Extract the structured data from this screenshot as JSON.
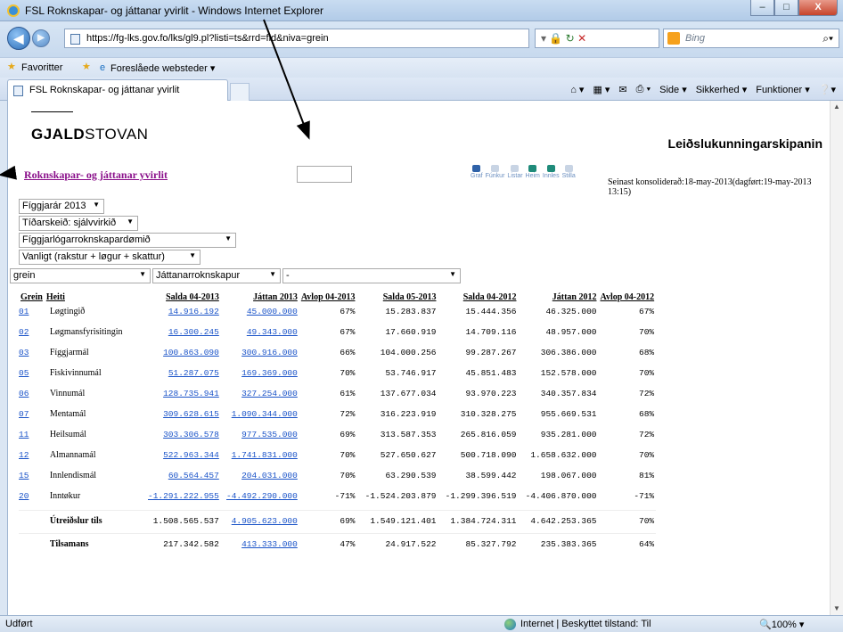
{
  "window": {
    "title": "FSL Roknskapar- og játtanar yvirlit - Windows Internet Explorer",
    "minimize": "–",
    "maximize": "□",
    "close": "X"
  },
  "addressbar": {
    "url": "https://fg-lks.gov.fo/lks/gl9.pl?listi=ts&rrd=fld&niva=grein",
    "search_placeholder": "Bing"
  },
  "favorites": {
    "favoritter": "Favoritter",
    "suggested": "Foreslåede websteder ▾"
  },
  "tab": {
    "label": "FSL Roknskapar- og játtanar yvirlit"
  },
  "commandbar": {
    "side": "Side ▾",
    "sikkerhed": "Sikkerhed ▾",
    "funktioner": "Funktioner ▾"
  },
  "page": {
    "logo_bold": "GJALD",
    "logo_rest": "STOVAN",
    "site_title": "Leiðslukunningarskipanin",
    "title": "Roknskapar- og játtanar yvirlit",
    "tools": [
      "Graf",
      "Fúnkur",
      "Listar",
      "Heim",
      "Innles",
      "Stilla"
    ],
    "consolidated": "Seinast konsoliderað:18-may-2013(dagført:19-may-2013 13:15)"
  },
  "filters": {
    "year": "Fíggjarár 2013",
    "period": "Tíðarskeið: sjálvvirkið",
    "area": "Fíggjarlógarroknskapardømið",
    "type": "Vanligt (rakstur + løgur + skattur)",
    "level": "grein",
    "account": "Játtanarroknskapur",
    "dash": "-"
  },
  "table": {
    "headers": [
      "Grein",
      "Heiti",
      "Salda 04-2013",
      "Játtan 2013",
      "Avlop 04-2013",
      "Salda 05-2013",
      "Salda 04-2012",
      "Játtan 2012",
      "Avlop 04-2012"
    ],
    "rows": [
      {
        "code": "01",
        "name": "Løgtingið",
        "s0413": "14.916.192",
        "j13": "45.000.000",
        "a0413": "67%",
        "s0513": "15.283.837",
        "s0412": "15.444.356",
        "j12": "46.325.000",
        "a0412": "67%"
      },
      {
        "code": "02",
        "name": "Løgmansfyrisitingin",
        "s0413": "16.300.245",
        "j13": "49.343.000",
        "a0413": "67%",
        "s0513": "17.660.919",
        "s0412": "14.709.116",
        "j12": "48.957.000",
        "a0412": "70%"
      },
      {
        "code": "03",
        "name": "Fíggjarmál",
        "s0413": "100.863.090",
        "j13": "300.916.000",
        "a0413": "66%",
        "s0513": "104.000.256",
        "s0412": "99.287.267",
        "j12": "306.386.000",
        "a0412": "68%"
      },
      {
        "code": "05",
        "name": "Fiskivinnumál",
        "s0413": "51.287.075",
        "j13": "169.369.000",
        "a0413": "70%",
        "s0513": "53.746.917",
        "s0412": "45.851.483",
        "j12": "152.578.000",
        "a0412": "70%"
      },
      {
        "code": "06",
        "name": "Vinnumál",
        "s0413": "128.735.941",
        "j13": "327.254.000",
        "a0413": "61%",
        "s0513": "137.677.034",
        "s0412": "93.970.223",
        "j12": "340.357.834",
        "a0412": "72%"
      },
      {
        "code": "07",
        "name": "Mentamál",
        "s0413": "309.628.615",
        "j13": "1.090.344.000",
        "a0413": "72%",
        "s0513": "316.223.919",
        "s0412": "310.328.275",
        "j12": "955.669.531",
        "a0412": "68%"
      },
      {
        "code": "11",
        "name": "Heilsumál",
        "s0413": "303.306.578",
        "j13": "977.535.000",
        "a0413": "69%",
        "s0513": "313.587.353",
        "s0412": "265.816.059",
        "j12": "935.281.000",
        "a0412": "72%"
      },
      {
        "code": "12",
        "name": "Almannamál",
        "s0413": "522.963.344",
        "j13": "1.741.831.000",
        "a0413": "70%",
        "s0513": "527.650.627",
        "s0412": "500.718.090",
        "j12": "1.658.632.000",
        "a0412": "70%"
      },
      {
        "code": "15",
        "name": "Innlendismál",
        "s0413": "60.564.457",
        "j13": "204.031.000",
        "a0413": "70%",
        "s0513": "63.290.539",
        "s0412": "38.599.442",
        "j12": "198.067.000",
        "a0412": "81%"
      },
      {
        "code": "20",
        "name": "Inntøkur",
        "s0413": "-1.291.222.955",
        "j13": "-4.492.290.000",
        "a0413": "-71%",
        "s0513": "-1.524.203.879",
        "s0412": "-1.299.396.519",
        "j12": "-4.406.870.000",
        "a0412": "-71%"
      }
    ],
    "totals": [
      {
        "name": "Útreiðslur tils",
        "s0413": "1.508.565.537",
        "j13": "4.905.623.000",
        "a0413": "69%",
        "s0513": "1.549.121.401",
        "s0412": "1.384.724.311",
        "j12": "4.642.253.365",
        "a0412": "70%"
      },
      {
        "name": "Tilsamans",
        "s0413": "217.342.582",
        "j13": "413.333.000",
        "a0413": "47%",
        "s0513": "24.917.522",
        "s0412": "85.327.792",
        "j12": "235.383.365",
        "a0412": "64%"
      }
    ]
  },
  "status": {
    "left": "Udført",
    "zone": "Internet | Beskyttet tilstand: Til",
    "zoom": "100%"
  }
}
